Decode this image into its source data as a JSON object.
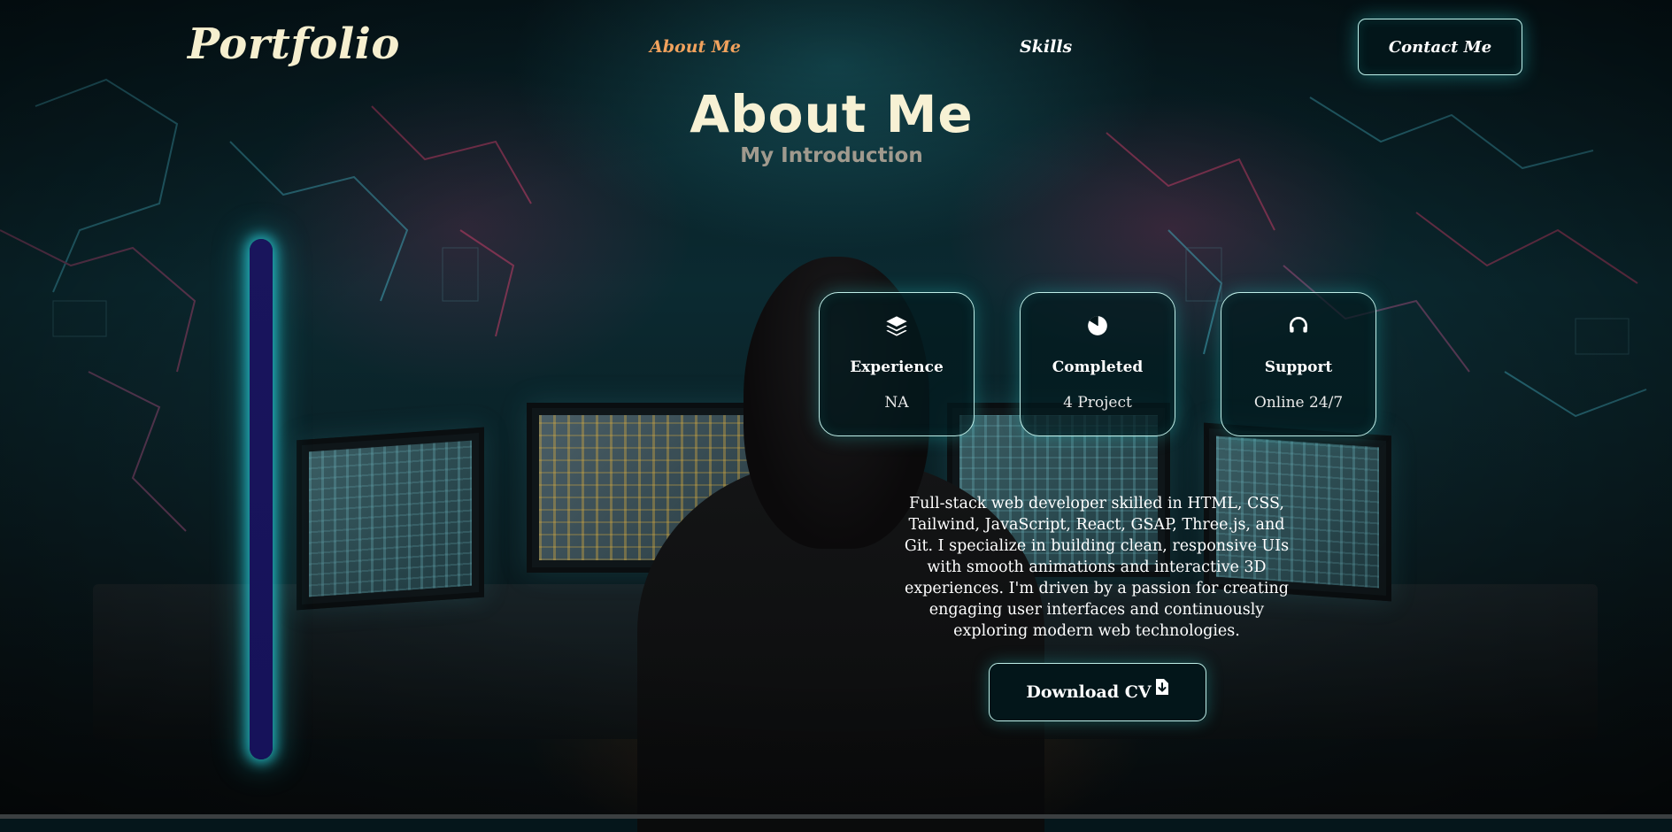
{
  "navbar": {
    "logo": "Portfolio",
    "links": [
      {
        "label": "About Me",
        "active": true
      },
      {
        "label": "Skills",
        "active": false
      }
    ],
    "contact_label": "Contact Me"
  },
  "header": {
    "title": "About Me",
    "subtitle": "My Introduction"
  },
  "cards": [
    {
      "icon": "layers-icon",
      "title": "Experience",
      "value": "NA"
    },
    {
      "icon": "pie-chart-icon",
      "title": "Completed",
      "value": "4 Project"
    },
    {
      "icon": "headset-icon",
      "title": "Support",
      "value": "Online 24/7"
    }
  ],
  "description": "Full-stack web developer skilled in HTML, CSS, Tailwind, JavaScript, React, GSAP, Three.js, and Git. I specialize in building clean, responsive UIs with smooth animations and interactive 3D experiences. I'm driven by a passion for creating engaging user interfaces and continuously exploring modern web technologies.",
  "download": {
    "label": "Download CV",
    "icon": "file-download-icon"
  },
  "colors": {
    "accent_nav": "#f1a25d",
    "glow": "#28c8c8",
    "title": "#f7f1d4",
    "subtitle": "#a09a8e",
    "side_bar": "#19155c"
  }
}
